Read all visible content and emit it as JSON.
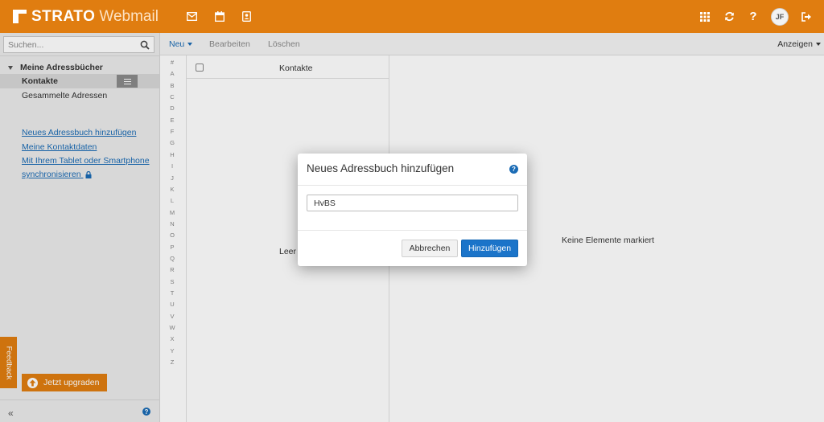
{
  "brand": {
    "name_bold": "STRATO",
    "name_light": "Webmail"
  },
  "topbar": {
    "app_icons": [
      "mail-icon",
      "calendar-icon",
      "contacts-icon"
    ],
    "right_icons": [
      "apps-grid-icon",
      "refresh-icon",
      "help-icon"
    ],
    "avatar_initials": "JF",
    "accent_color": "#e07d10"
  },
  "sidebar": {
    "search_placeholder": "Suchen...",
    "section_title": "Meine Adressbücher",
    "items": [
      {
        "label": "Kontakte",
        "selected": true
      },
      {
        "label": "Gesammelte Adressen",
        "selected": false
      }
    ],
    "links": [
      "Neues Adressbuch hinzufügen",
      "Meine Kontaktdaten",
      "Mit Ihrem Tablet oder Smartphone",
      "synchronisieren"
    ],
    "upgrade_label": "Jetzt upgraden",
    "feedback_label": "Feedback",
    "collapse_label": "«"
  },
  "toolbar": {
    "new_label": "Neu",
    "edit_label": "Bearbeiten",
    "delete_label": "Löschen",
    "view_label": "Anzeigen"
  },
  "letters": [
    "#",
    "A",
    "B",
    "C",
    "D",
    "E",
    "F",
    "G",
    "H",
    "I",
    "J",
    "K",
    "L",
    "M",
    "N",
    "O",
    "P",
    "Q",
    "R",
    "S",
    "T",
    "U",
    "V",
    "W",
    "X",
    "Y",
    "Z"
  ],
  "list": {
    "header_title": "Kontakte",
    "empty_text": "Leer"
  },
  "detail": {
    "empty_message": "Keine Elemente markiert"
  },
  "modal": {
    "title": "Neues Adressbuch hinzufügen",
    "input_value": "HvBS",
    "cancel_label": "Abbrechen",
    "add_label": "Hinzufügen"
  }
}
